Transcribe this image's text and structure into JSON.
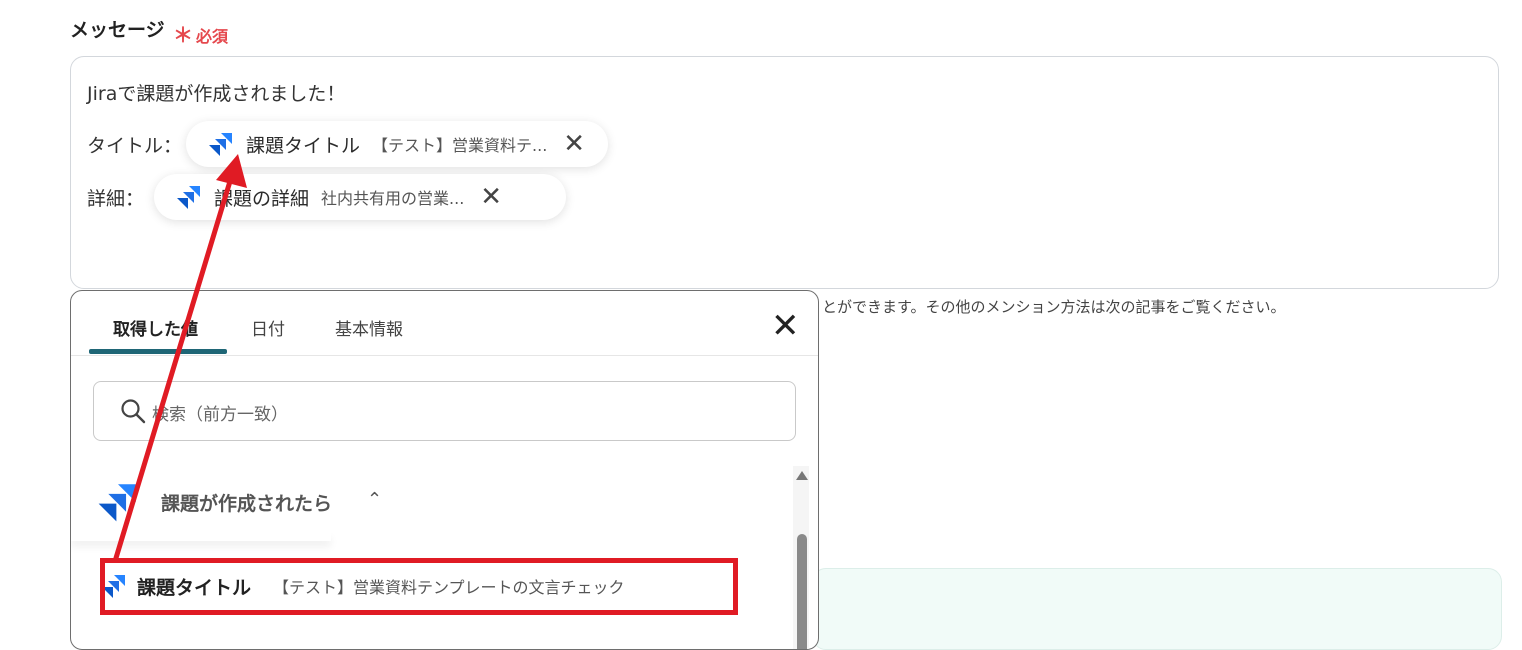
{
  "field": {
    "label": "メッセージ",
    "required_mark": "＊",
    "required_text": "必須"
  },
  "message": {
    "line1": "Jiraで課題が作成されました！",
    "title_prefix": "タイトル：",
    "detail_prefix": "詳細：",
    "chip_title": {
      "name": "課題タイトル",
      "value": "【テスト】営業資料テ...",
      "remove": "✕"
    },
    "chip_detail": {
      "name": "課題の詳細",
      "value": "社内共有用の営業...",
      "remove": "✕"
    }
  },
  "help_text": "とができます。その他のメンション方法は次の記事をご覧ください。",
  "popup": {
    "tabs": [
      "取得した値",
      "日付",
      "基本情報"
    ],
    "close": "✕",
    "search_placeholder": "検索（前方一致）",
    "group_label": "課題が作成されたら",
    "group_caret": "⌃",
    "item": {
      "name": "課題タイトル",
      "value": "【テスト】営業資料テンプレートの文言チェック"
    }
  },
  "colors": {
    "accent_tab": "#1f6676",
    "required": "#e5484d",
    "annotation": "#e01b24",
    "jira_blue": "#2684ff"
  }
}
